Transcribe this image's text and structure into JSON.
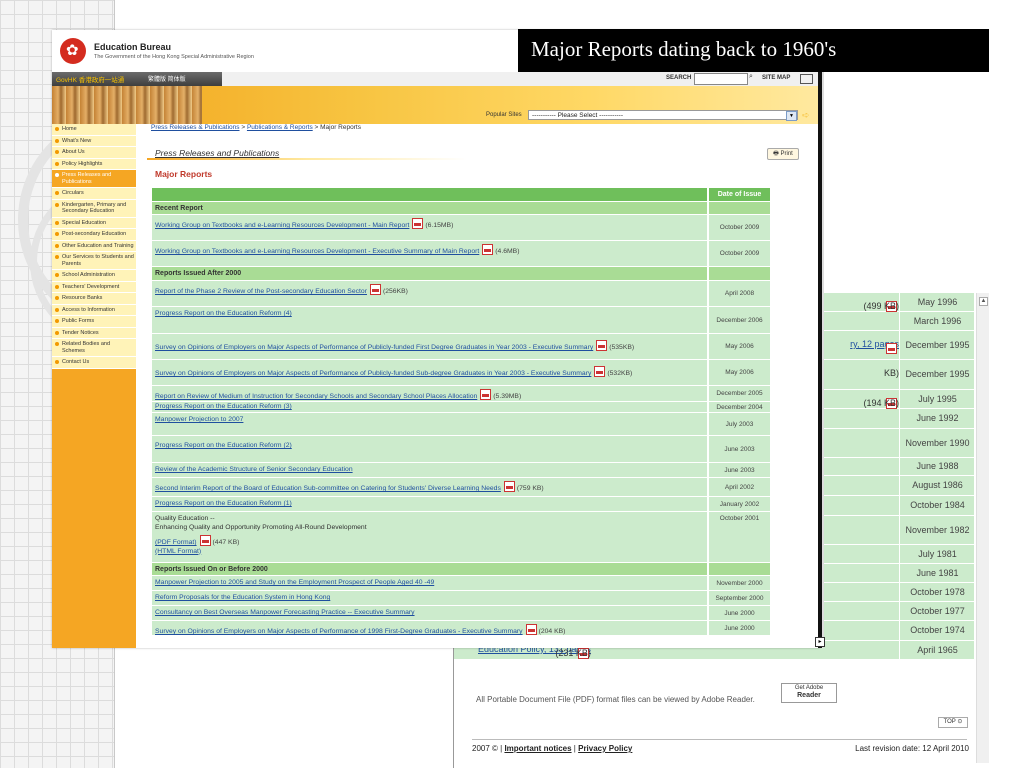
{
  "slide": {
    "title": "Major Reports dating back to 1960's"
  },
  "header": {
    "bureau_name": "Education Bureau",
    "bureau_sub": "The Government of the Hong Kong Special Administrative Region",
    "govhk": "GovHK 香港政府一站通",
    "langs": "繁體版  简体版",
    "search_label": "SEARCH",
    "sitemap": "SITE MAP",
    "popular_label": "Popular Sites",
    "popular_select": "----------- Please Select -----------"
  },
  "sidebar": {
    "items": [
      {
        "label": "Home"
      },
      {
        "label": "What's New"
      },
      {
        "label": "About Us"
      },
      {
        "label": "Policy Highlights"
      },
      {
        "label": "Press Releases and Publications"
      },
      {
        "label": "Circulars"
      },
      {
        "label": "Kindergarten, Primary and Secondary Education"
      },
      {
        "label": "Special Education"
      },
      {
        "label": "Post-secondary Education"
      },
      {
        "label": "Other Education and Training"
      },
      {
        "label": "Our Services to Students and Parents"
      },
      {
        "label": "School Administration"
      },
      {
        "label": "Teachers' Development"
      },
      {
        "label": "Resource Banks"
      },
      {
        "label": "Access to Information"
      },
      {
        "label": "Public Forms"
      },
      {
        "label": "Tender Notices"
      },
      {
        "label": "Related Bodies and Schemes"
      },
      {
        "label": "Contact Us"
      }
    ]
  },
  "content": {
    "crumb_1": "Press Releases & Publications",
    "crumb_2": "Publications & Reports",
    "crumb_3": "Major Reports",
    "section_title": "Press Releases and Publications",
    "print_label": "Print",
    "major_label": "Major Reports",
    "col_date": "Date of Issue",
    "group_recent": "Recent Report",
    "group_after": "Reports Issued After 2000",
    "group_before": "Reports Issued On or Before 2000",
    "rows": [
      {
        "title": "Working Group on Textbooks and e-Learning Resources Development - Main Report",
        "size": "(6.15MB)",
        "date": "October 2009"
      },
      {
        "title": "Working Group on Textbooks and e-Learning Resources Development - Executive Summary of Main Report",
        "size": "(4.6MB)",
        "date": "October 2009"
      },
      {
        "title": "Report of the Phase 2 Review of the Post-secondary Education Sector",
        "size": "(256KB)",
        "date": "April 2008"
      },
      {
        "title": "Progress Report on the Education Reform (4)",
        "size": "",
        "date": "December 2006"
      },
      {
        "title": "Survey on Opinions of Employers on Major Aspects of Performance of Publicly-funded First Degree Graduates in Year 2003 - Executive Summary",
        "size": "(535KB)",
        "date": "May 2006"
      },
      {
        "title": "Survey on Opinions of Employers on Major Aspects of Performance of Publicly-funded Sub-degree Graduates in Year 2003 - Executive Summary",
        "size": "(532KB)",
        "date": "May 2006"
      },
      {
        "title": "Report on Review of Medium of Instruction for Secondary Schools and Secondary School Places Allocation",
        "size": "(5.39MB)",
        "date": "December 2005"
      },
      {
        "title": "Progress Report on the Education Reform (3)",
        "size": "",
        "date": "December 2004"
      },
      {
        "title": "Manpower Projection to 2007",
        "size": "",
        "date": "July 2003"
      },
      {
        "title": "Progress Report on the Education Reform (2)",
        "size": "",
        "date": "June 2003"
      },
      {
        "title": "Review of the Academic Structure of Senior Secondary Education",
        "size": "",
        "date": "June 2003"
      },
      {
        "title": "Second Interim Report of the Board of Education Sub-committee on Catering for Students' Diverse Learning Needs",
        "size": "(759 KB)",
        "date": "April 2002"
      },
      {
        "title": "Progress Report on the Education Reform (1)",
        "size": "",
        "date": "January 2002"
      },
      {
        "title": "Manpower Projection to 2005 and Study on the Employment Prospect of People Aged 40 -49",
        "size": "",
        "date": "November 2000"
      },
      {
        "title": "Reform Proposals for the Education System in Hong Kong",
        "size": "",
        "date": "September 2000"
      },
      {
        "title": "Consultancy on Best Overseas Manpower Forecasting Practice -- Executive Summary",
        "size": "",
        "date": "June 2000"
      },
      {
        "title": "Survey on Opinions of Employers on Major Aspects of Performance of 1998 First-Degree Graduates - Executive Summary",
        "size": "(204 KB)",
        "date": "June 2000"
      }
    ],
    "quality": {
      "line1": "Quality Education --",
      "line2": "Enhancing Quality and Opportunity Promoting All-Round Development",
      "pdf": "(PDF Format)",
      "size": "(447 KB)",
      "html": "(HTML Format)",
      "date": "October 2001"
    }
  },
  "back": {
    "rows": [
      {
        "left": "(499 KB)",
        "date": "May 1996"
      },
      {
        "left": "",
        "date": "March 1996"
      },
      {
        "left": "ry, 12 pages",
        "date": "December 1995"
      },
      {
        "left": "KB)",
        "date": "December 1995"
      },
      {
        "left": "(194 KB)",
        "date": "July 1995"
      },
      {
        "left": "",
        "date": "June 1992"
      },
      {
        "left": "",
        "date": "November 1990"
      },
      {
        "left": "",
        "date": "June 1988"
      },
      {
        "left": "",
        "date": "August 1986"
      },
      {
        "left": "",
        "date": "October 1984"
      },
      {
        "left": "",
        "date": "November 1982"
      },
      {
        "left": "",
        "date": "July 1981"
      },
      {
        "left": "",
        "date": "June 1981"
      },
      {
        "left": "",
        "date": "October 1978"
      },
      {
        "left": "",
        "date": "October 1977"
      },
      {
        "left": "",
        "date": "October 1974"
      }
    ],
    "last_row_title": "Education Policy, 131 pages",
    "last_row_size": "(231 KB)",
    "last_row_date": "April 1965",
    "adobe_note": "All Portable Document File (PDF) format files can be viewed by Adobe Reader.",
    "adobe_top": "Get Adobe",
    "adobe_bottom": "Reader",
    "top_label": "TOP",
    "footer_year": "2007 © |",
    "footer_notices": "Important notices",
    "footer_privacy": "Privacy Policy",
    "footer_revision": "Last revision date: 12 April 2010"
  }
}
